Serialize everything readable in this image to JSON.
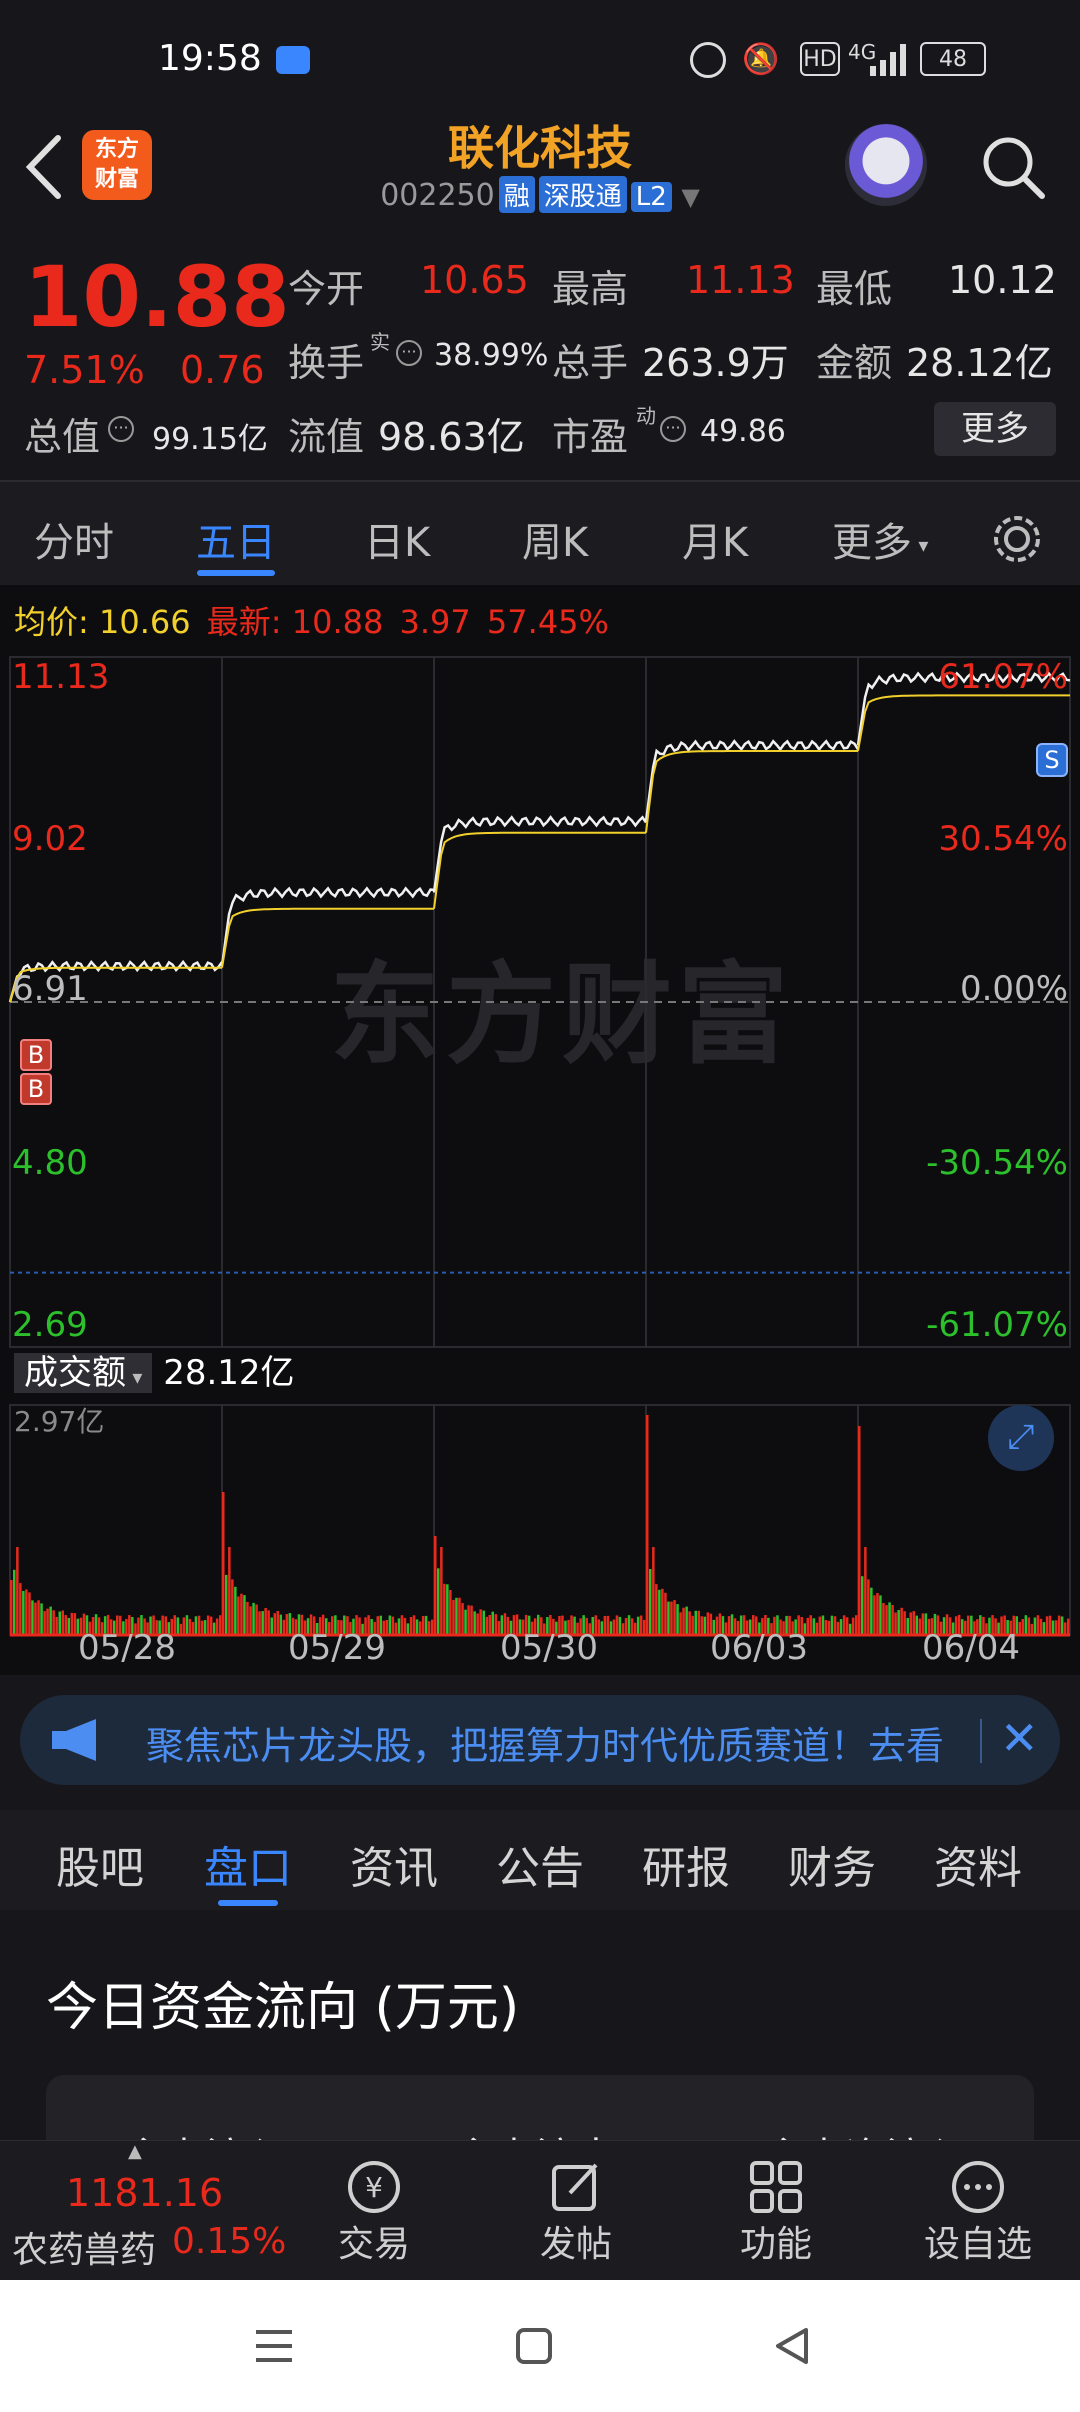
{
  "status_bar": {
    "time": "19:58",
    "network": "4G",
    "battery": "48",
    "hd": "HD"
  },
  "header": {
    "logo_text_1": "东方",
    "logo_text_2": "财富",
    "stock_name": "联化科技",
    "stock_code": "002250",
    "tag_margin": "融",
    "tag_connect": "深股通",
    "tag_level": "L2"
  },
  "quote": {
    "price": "10.88",
    "change_pct": "7.51%",
    "change_amt": "0.76",
    "open_label": "今开",
    "open": "10.65",
    "high_label": "最高",
    "high": "11.13",
    "low_label": "最低",
    "low": "10.12",
    "turnover_label": "换手",
    "turnover_sup": "实",
    "turnover": "38.99%",
    "volume_label": "总手",
    "volume": "263.9万",
    "amount_label": "金额",
    "amount": "28.12亿",
    "mktcap_label": "总值",
    "mktcap": "99.15亿",
    "float_label": "流值",
    "float_cap": "98.63亿",
    "pe_label": "市盈",
    "pe_sup": "动",
    "pe": "49.86",
    "more_button": "更多"
  },
  "chart_tabs": [
    "分时",
    "五日",
    "日K",
    "周K",
    "月K",
    "更多"
  ],
  "chart": {
    "avg_label": "均价:",
    "avg_value": "10.66",
    "latest_label": "最新:",
    "latest_value": "10.88",
    "latest_change": "3.97",
    "latest_pct": "57.45%",
    "left_axis": [
      "11.13",
      "9.02",
      "6.91",
      "4.80",
      "2.69"
    ],
    "right_axis": [
      "61.07%",
      "30.54%",
      "0.00%",
      "-30.54%",
      "-61.07%"
    ],
    "watermark": "东方财富",
    "marker_b": "B",
    "marker_s": "S",
    "volume_selector": "成交额",
    "volume_total": "28.12亿",
    "volume_max": "2.97亿",
    "dates": [
      "05/28",
      "05/29",
      "05/30",
      "06/03",
      "06/04"
    ]
  },
  "chart_data": {
    "type": "line",
    "x": [
      "05/28",
      "05/29",
      "05/30",
      "06/03",
      "06/04"
    ],
    "series": [
      {
        "name": "最新",
        "values": [
          7.35,
          8.25,
          9.12,
          10.05,
          10.88
        ]
      },
      {
        "name": "均价",
        "values": [
          7.33,
          8.05,
          8.98,
          9.98,
          10.66
        ]
      }
    ],
    "ylim": [
      2.69,
      11.13
    ],
    "reference": 6.91,
    "volume_ymax": 2.97
  },
  "banner": {
    "text": "聚焦芯片龙头股，把握算力时代优质赛道！去看"
  },
  "info_tabs": [
    "股吧",
    "盘口",
    "资讯",
    "公告",
    "研报",
    "财务",
    "资料"
  ],
  "fund_flow": {
    "title": "今日资金流向 (万元)",
    "col_in": "主力流入",
    "col_out": "主力流出",
    "col_net": "主力净流入"
  },
  "app_bar": {
    "index_value": "1181.16",
    "index_name": "农药兽药",
    "index_pct": "0.15%",
    "trade": "交易",
    "post": "发帖",
    "function": "功能",
    "watchlist": "设自选"
  },
  "colors": {
    "up": "#e8291c",
    "down": "#2cc12c",
    "accent": "#3a86ff",
    "brand": "#f2a225"
  }
}
